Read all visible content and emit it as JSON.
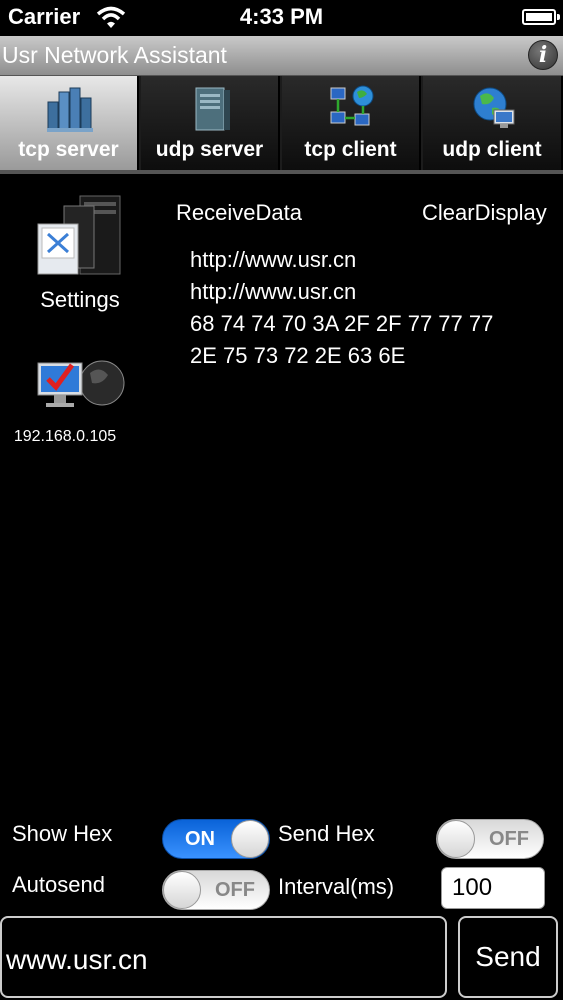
{
  "status_bar": {
    "carrier": "Carrier",
    "time": "4:33 PM"
  },
  "app": {
    "title": "Usr Network Assistant",
    "info_icon_glyph": "i"
  },
  "tabs": [
    {
      "label": "tcp server",
      "icon": "server-cluster-icon",
      "active": true
    },
    {
      "label": "udp server",
      "icon": "server-tower-icon",
      "active": false
    },
    {
      "label": "tcp client",
      "icon": "network-computers-icon",
      "active": false
    },
    {
      "label": "udp client",
      "icon": "globe-computer-icon",
      "active": false
    }
  ],
  "left_panel": {
    "settings_label": "Settings",
    "ip_address": "192.168.0.105"
  },
  "receive": {
    "receive_data_label": "ReceiveData",
    "clear_display_label": "ClearDisplay",
    "lines": [
      "http://www.usr.cn",
      "http://www.usr.cn",
      "68 74 74 70 3A 2F 2F 77 77 77",
      "2E 75 73 72 2E 63 6E"
    ]
  },
  "controls": {
    "show_hex_label": "Show Hex",
    "show_hex_state": "ON",
    "send_hex_label": "Send Hex",
    "send_hex_state": "OFF",
    "autosend_label": "Autosend",
    "autosend_state": "OFF",
    "interval_label": "Interval(ms)",
    "interval_value": "100"
  },
  "send": {
    "input_value": "www.usr.cn",
    "button_label": "Send"
  },
  "colors": {
    "switch_on": "#1a76ef",
    "background": "#000000",
    "titlebar": "#a6a6a6"
  }
}
